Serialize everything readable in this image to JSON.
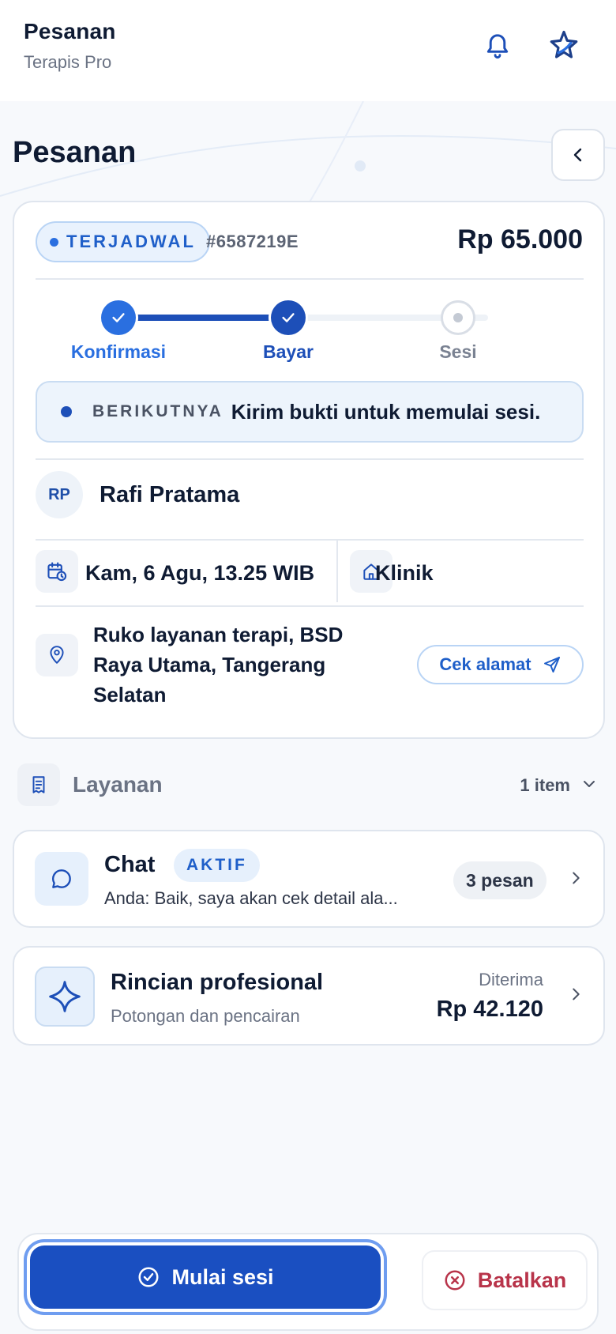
{
  "header": {
    "title": "Pesanan",
    "subtitle": "Terapis Pro"
  },
  "page": {
    "title": "Pesanan"
  },
  "order": {
    "status": "TERJADWAL",
    "id": "#6587219E",
    "price": "Rp 65.000",
    "steps": [
      {
        "label": "Konfirmasi",
        "state": "done"
      },
      {
        "label": "Bayar",
        "state": "done"
      },
      {
        "label": "Sesi",
        "state": "pending"
      }
    ],
    "next": {
      "label": "BERIKUTNYA",
      "text": "Kirim bukti untuk memulai sesi."
    },
    "client": {
      "initials": "RP",
      "name": "Rafi Pratama"
    },
    "schedule": "Kam, 6 Agu, 13.25 WIB",
    "location_type": "Klinik",
    "address": "Ruko layanan terapi, BSD Raya Utama, Tangerang Selatan",
    "check_address_label": "Cek alamat"
  },
  "services": {
    "label": "Layanan",
    "count": "1 item"
  },
  "chat": {
    "title": "Chat",
    "badge": "AKTIF",
    "preview": "Anda: Baik, saya akan cek detail ala...",
    "count": "3 pesan"
  },
  "professional": {
    "title": "Rincian profesional",
    "subtitle": "Potongan dan pencairan",
    "received_label": "Diterima",
    "amount": "Rp 42.120"
  },
  "actions": {
    "start_label": "Mulai sesi",
    "cancel_label": "Batalkan"
  },
  "colors": {
    "primary": "#1a4fc1",
    "accent": "#1f5fc9",
    "danger": "#b8344a",
    "text": "#0f1b33",
    "muted": "#6b7384"
  },
  "icons": [
    "bell-icon",
    "sparkle-logo-icon",
    "chevron-left-icon",
    "check-icon",
    "calendar-clock-icon",
    "home-icon",
    "map-pin-icon",
    "send-icon",
    "receipt-icon",
    "chevron-down-icon",
    "chat-bubble-icon",
    "chevron-right-icon",
    "sparkle-icon",
    "check-circle-icon",
    "x-circle-icon"
  ]
}
